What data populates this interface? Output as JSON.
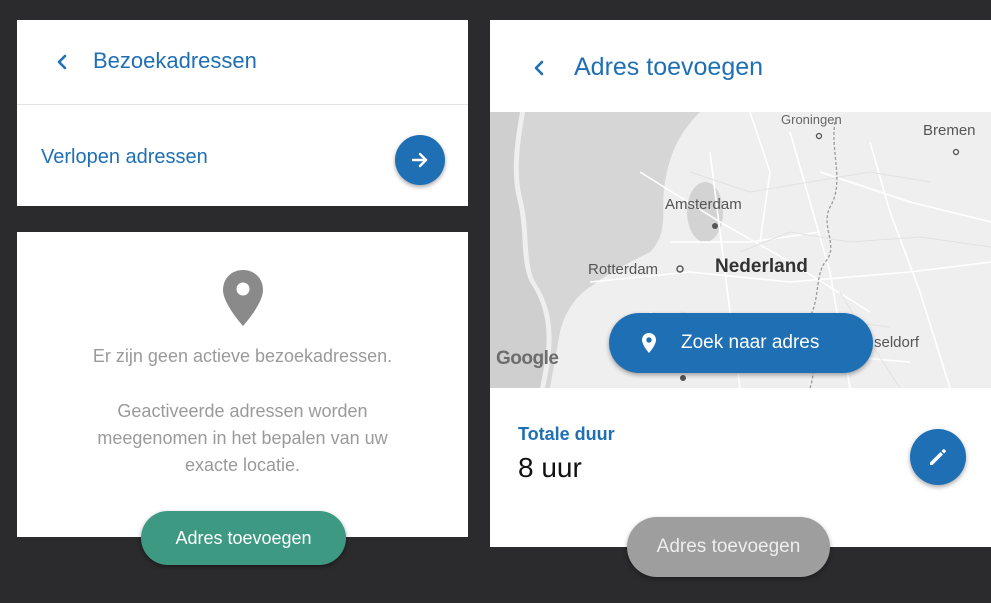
{
  "left": {
    "header": {
      "title": "Bezoekadressen"
    },
    "expired": {
      "label": "Verlopen adressen"
    },
    "empty_state": {
      "line1": "Er zijn geen actieve bezoekadressen.",
      "line2": "Geactiveerde adressen worden meegenomen in het bepalen van uw exacte locatie."
    },
    "add_button": "Adres toevoegen"
  },
  "right": {
    "header": {
      "title": "Adres toevoegen"
    },
    "map": {
      "labels": {
        "groningen": "Groningen",
        "bremen": "Bremen",
        "amsterdam": "Amsterdam",
        "rotterdam": "Rotterdam",
        "nederland": "Nederland",
        "dusseldorf": "seldorf"
      },
      "logo": "Google",
      "search_label": "Zoek naar adres"
    },
    "duration": {
      "label": "Totale duur",
      "value": "8 uur"
    },
    "add_button": "Adres toevoegen"
  },
  "colors": {
    "primary_blue": "#1f6fb5",
    "teal": "#3d9982",
    "disabled_grey": "#9e9e9e",
    "background": "#2b2b2d"
  },
  "icons": {
    "back": "chevron-left-icon",
    "arrow": "arrow-right-icon",
    "pin": "location-pin-icon",
    "edit": "pencil-icon"
  }
}
